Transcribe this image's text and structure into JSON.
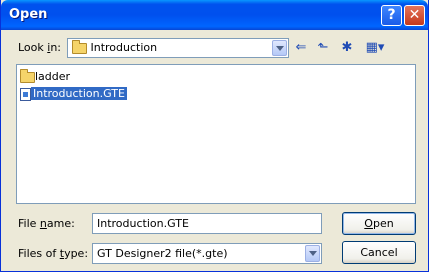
{
  "window": {
    "title": "Open",
    "help_glyph": "?",
    "close_glyph": "✕"
  },
  "lookin": {
    "label_pre": "Look ",
    "label_key": "i",
    "label_post": "n:",
    "value": "Introduction"
  },
  "toolbar": {
    "back_glyph": "⇐",
    "up_glyph": "⬑",
    "newfolder_glyph": "✱",
    "views_glyph": "▦▾"
  },
  "files": [
    {
      "name": "ladder",
      "icon": "folder-icon",
      "selected": false
    },
    {
      "name": "Introduction.GTE",
      "icon": "document-icon",
      "selected": true
    }
  ],
  "filename": {
    "label_pre": "File ",
    "label_key": "n",
    "label_post": "ame:",
    "value": "Introduction.GTE"
  },
  "filetype": {
    "label_pre": "Files of ",
    "label_key": "t",
    "label_post": "ype:",
    "value": "GT Designer2 file(*.gte)"
  },
  "buttons": {
    "open_key": "O",
    "open_rest": "pen",
    "cancel": "Cancel"
  },
  "colors": {
    "titlebar": "#0053EE",
    "selection": "#316AC5",
    "dialog_bg": "#ECE9D8"
  }
}
